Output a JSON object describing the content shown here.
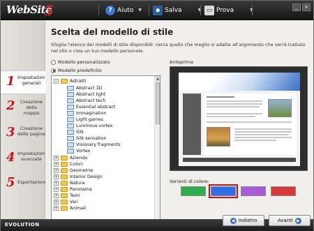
{
  "app": {
    "logo_text": "WebSite",
    "logo_number": "5",
    "bottom_label": "EVOLUTION"
  },
  "toolbar": {
    "help_label": "Aiuto",
    "save_label": "Salva",
    "test_label": "Prova"
  },
  "sidebar": {
    "items": [
      {
        "number": "1",
        "label": "Impostazioni generali",
        "active": true
      },
      {
        "number": "2",
        "label": "Creazione della mappa",
        "active": false
      },
      {
        "number": "3",
        "label": "Creazione delle pagine",
        "active": false
      },
      {
        "number": "4",
        "label": "Impostazioni avanzate",
        "active": false
      },
      {
        "number": "5",
        "label": "Esportazione",
        "active": false
      }
    ]
  },
  "main": {
    "title": "Scelta del modello di stile",
    "description": "Sfoglia l'elenco dei modelli di stile disponibili: cerca quello che meglio si adatta all'argomento che verrà trattato nel sito o crea un tuo modello personale.",
    "radio_custom": "Modello personalizzato",
    "radio_predefined": "Modello predefinito",
    "preview_label": "Anteprima",
    "variants_label": "Varianti di colore:"
  },
  "tree": {
    "expanded_folder": "Astratti",
    "children": [
      "Abstract 3D",
      "Abstract light",
      "Abstract tech",
      "Essential abstract",
      "Immagination",
      "Light games",
      "Luminous vortex",
      "Silk",
      "Silk sensation",
      "Visionary fragments",
      "Vortex"
    ],
    "folders": [
      "Azienda",
      "Colori",
      "Geometrie",
      "Interior Design",
      "Natura",
      "Panorama",
      "Temi",
      "Vari",
      "Animali"
    ]
  },
  "variants": {
    "colors": [
      "#2fae4f",
      "#2f6ee8",
      "#a95ad9",
      "#d9393b"
    ],
    "selected_index": 1
  },
  "buttons": {
    "back_label": "Indietro",
    "next_label": "Avanti"
  }
}
